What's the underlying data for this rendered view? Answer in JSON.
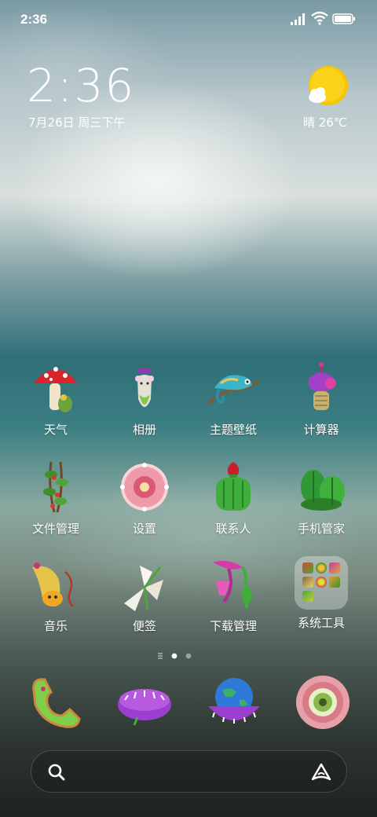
{
  "status_bar": {
    "time": "2:36",
    "icons": [
      "signal-icon",
      "wifi-icon",
      "battery-icon"
    ]
  },
  "clock_widget": {
    "time": "2:36",
    "date": "7月26日 周三下午"
  },
  "weather_widget": {
    "text": "晴 26℃",
    "icon": "sun-cloud-icon"
  },
  "apps": [
    {
      "label": "天气",
      "icon": "mushroom-icon"
    },
    {
      "label": "相册",
      "icon": "mouse-plant-icon"
    },
    {
      "label": "主题壁纸",
      "icon": "chameleon-icon"
    },
    {
      "label": "计算器",
      "icon": "cactus-flower-icon"
    },
    {
      "label": "文件管理",
      "icon": "vine-icon"
    },
    {
      "label": "设置",
      "icon": "pink-flower-icon"
    },
    {
      "label": "联系人",
      "icon": "strawberry-cactus-icon"
    },
    {
      "label": "手机管家",
      "icon": "cactus-cluster-icon"
    },
    {
      "label": "音乐",
      "icon": "horn-flower-icon"
    },
    {
      "label": "便签",
      "icon": "white-flower-bundle-icon"
    },
    {
      "label": "下载管理",
      "icon": "pink-pitcher-plant-icon"
    },
    {
      "label": "系统工具",
      "icon": "folder-icon"
    }
  ],
  "page_indicator": {
    "pages": 3,
    "active": 2
  },
  "dock": [
    "phone-icon",
    "messages-icon",
    "browser-icon",
    "camera-icon"
  ],
  "search_bar": {
    "search_icon": "search-icon",
    "assistant_icon": "assistant-icon"
  }
}
